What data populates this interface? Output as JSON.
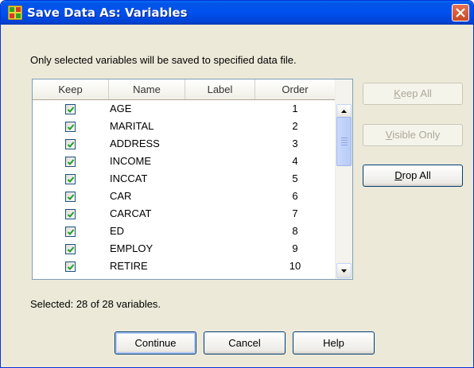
{
  "window": {
    "title": "Save Data As: Variables"
  },
  "instruction": "Only selected variables will be saved to specified data file.",
  "table": {
    "columns": [
      "Keep",
      "Name",
      "Label",
      "Order"
    ],
    "rows": [
      {
        "keep": true,
        "name": "AGE",
        "label": "",
        "order": "1"
      },
      {
        "keep": true,
        "name": "MARITAL",
        "label": "",
        "order": "2"
      },
      {
        "keep": true,
        "name": "ADDRESS",
        "label": "",
        "order": "3"
      },
      {
        "keep": true,
        "name": "INCOME",
        "label": "",
        "order": "4"
      },
      {
        "keep": true,
        "name": "INCCAT",
        "label": "",
        "order": "5"
      },
      {
        "keep": true,
        "name": "CAR",
        "label": "",
        "order": "6"
      },
      {
        "keep": true,
        "name": "CARCAT",
        "label": "",
        "order": "7"
      },
      {
        "keep": true,
        "name": "ED",
        "label": "",
        "order": "8"
      },
      {
        "keep": true,
        "name": "EMPLOY",
        "label": "",
        "order": "9"
      },
      {
        "keep": true,
        "name": "RETIRE",
        "label": "",
        "order": "10"
      }
    ]
  },
  "side_buttons": {
    "keep_all": {
      "accel": "K",
      "rest": "eep All",
      "enabled": false
    },
    "visible_only": {
      "accel": "V",
      "rest": "isible Only",
      "enabled": false
    },
    "drop_all": {
      "accel": "D",
      "rest": "rop All",
      "enabled": true
    }
  },
  "status": "Selected: 28 of 28 variables.",
  "buttons": {
    "continue": "Continue",
    "cancel": "Cancel",
    "help": "Help"
  },
  "colors": {
    "titlebar": "#0050ee",
    "dialog_bg": "#ece9d8",
    "check": "#21a121"
  },
  "icons": {
    "app": "spss-data-icon",
    "close": "close-icon",
    "check": "checkmark-icon",
    "scroll_up": "arrow-up-icon",
    "scroll_down": "arrow-down-icon"
  }
}
